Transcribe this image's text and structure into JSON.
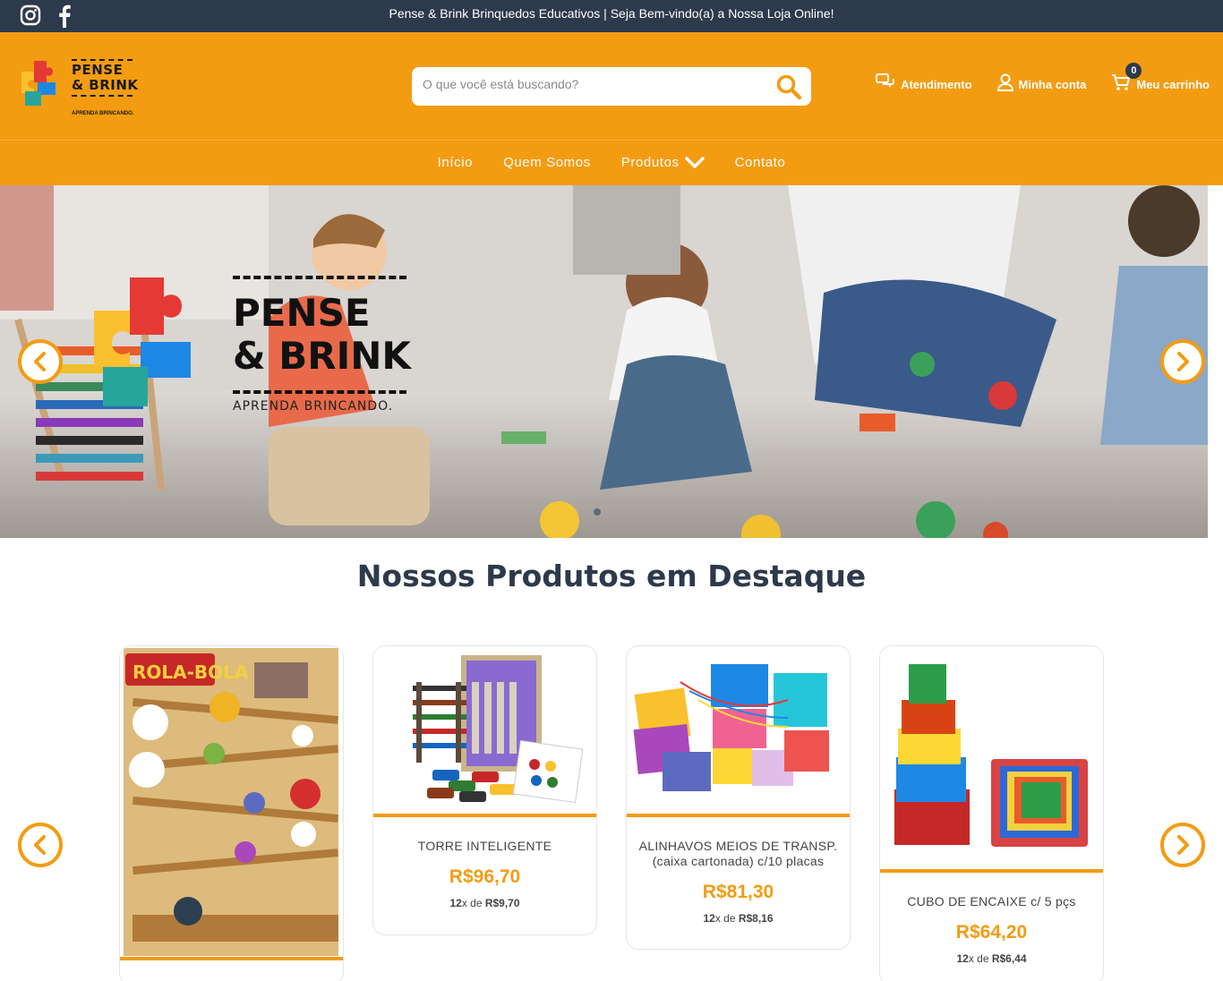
{
  "topbar": {
    "tagline": "Pense & Brink Brinquedos Educativos | Seja Bem-vindo(a) a Nossa Loja Online!",
    "social": [
      "instagram-icon",
      "facebook-icon"
    ]
  },
  "brand": {
    "line1": "PENSE",
    "line2": "& BRINK",
    "slogan": "APRENDA BRINCANDO."
  },
  "search": {
    "placeholder": "O que você está buscando?"
  },
  "header_links": {
    "support": "Atendimento",
    "account": "Minha conta",
    "cart": "Meu carrinho",
    "cart_count": "0"
  },
  "nav": [
    "Início",
    "Quem Somos",
    "Produtos",
    "Contato"
  ],
  "banner": {
    "line1": "PENSE",
    "line2": "& BRINK",
    "slogan": "APRENDA BRINCANDO."
  },
  "section_title": "Nossos Produtos em Destaque",
  "products": [
    {
      "name": "",
      "name2": "",
      "price": "",
      "installments": "",
      "inst_mid": "",
      "inst_val": ""
    },
    {
      "name": "TORRE INTELIGENTE",
      "name2": "",
      "price": "R$96,70",
      "installments": "12",
      "inst_mid": "x de ",
      "inst_val": "R$9,70"
    },
    {
      "name": "ALINHAVOS MEIOS DE TRANSP.",
      "name2": "(caixa cartonada) c/10 placas",
      "price": "R$81,30",
      "installments": "12",
      "inst_mid": "x de ",
      "inst_val": "R$8,16"
    },
    {
      "name": "CUBO DE ENCAIXE c/ 5 pçs",
      "name2": "",
      "price": "R$64,20",
      "installments": "12",
      "inst_mid": "x de ",
      "inst_val": "R$6,44"
    }
  ],
  "product_art": {
    "rola_bola": "ROLA-BOLA"
  },
  "colors": {
    "accent": "#f39c12",
    "dark": "#2d3a4b"
  }
}
